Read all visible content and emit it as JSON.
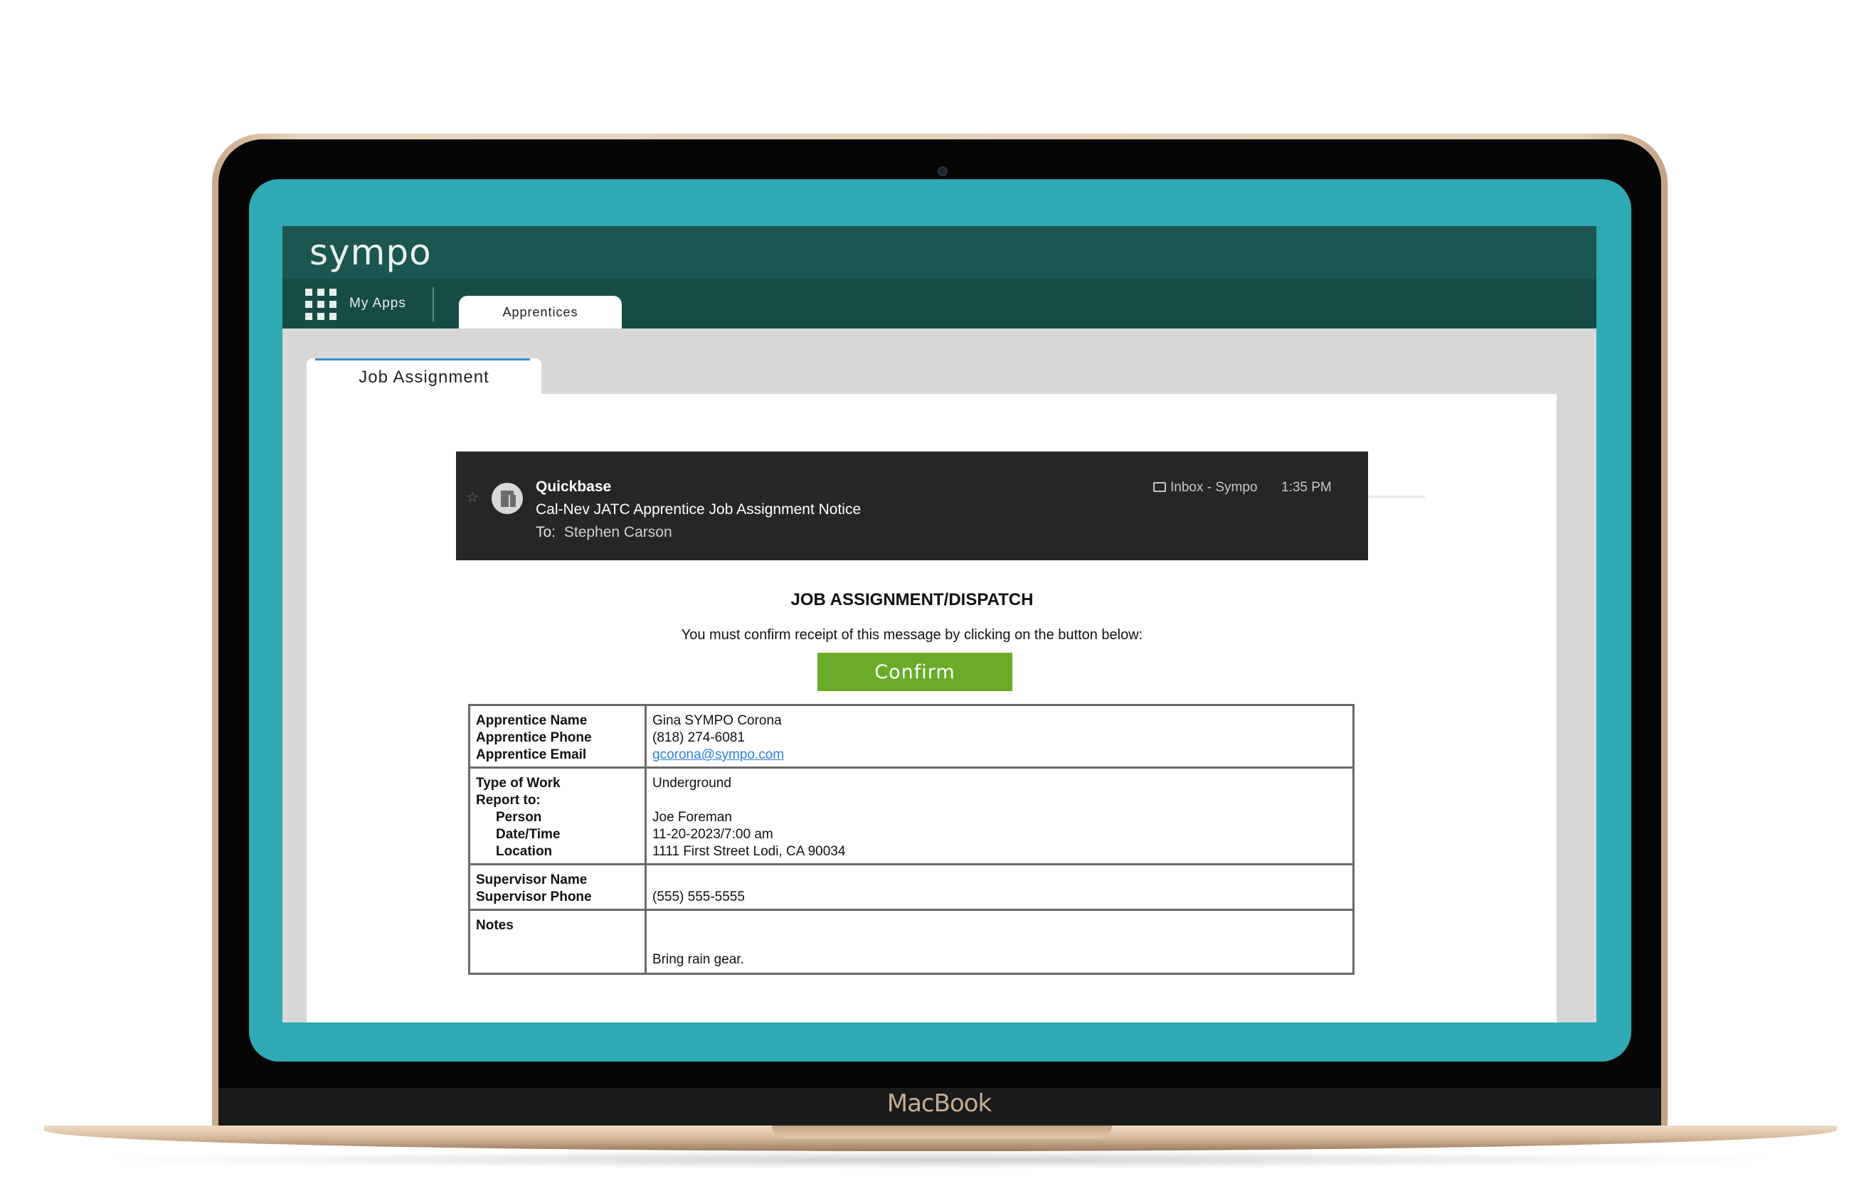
{
  "device": {
    "brand": "MacBook"
  },
  "app": {
    "logo": "sympo",
    "nav": {
      "my_apps": "My Apps",
      "tab_apprentices": "Apprentices"
    },
    "page_tab": "Job Assignment"
  },
  "email": {
    "from": "Quickbase",
    "subject": "Cal-Nev JATC Apprentice Job Assignment Notice",
    "to_label": "To:",
    "to_name": "Stephen Carson",
    "folder": "Inbox - Sympo",
    "time": "1:35 PM"
  },
  "body": {
    "title": "JOB ASSIGNMENT/DISPATCH",
    "confirm_message": "You must confirm receipt of this message by clicking on the button below:",
    "confirm_button": "Confirm"
  },
  "assignment": {
    "apprentice_name_label": "Apprentice Name",
    "apprentice_phone_label": "Apprentice Phone",
    "apprentice_email_label": "Apprentice Email",
    "apprentice_name": "Gina SYMPO Corona",
    "apprentice_phone": "(818) 274-6081",
    "apprentice_email": "gcorona@sympo.com",
    "type_of_work_label": "Type of Work",
    "report_to_label": "Report to:",
    "person_label": "Person",
    "datetime_label": "Date/Time",
    "location_label": "Location",
    "type_of_work": "Underground",
    "person": "Joe Foreman",
    "datetime": "11-20-2023/7:00 am",
    "location": "1111 First Street Lodi, CA 90034",
    "supervisor_name_label": "Supervisor Name",
    "supervisor_phone_label": "Supervisor Phone",
    "supervisor_phone": "(555) 555-5555",
    "notes_label": "Notes",
    "notes": "Bring rain gear."
  },
  "colors": {
    "screen_teal": "#2fa9b2",
    "header_green": "#1b5650",
    "confirm_green": "#6aac28",
    "email_header_bg": "#262624",
    "link_blue": "#2f7fd9"
  }
}
